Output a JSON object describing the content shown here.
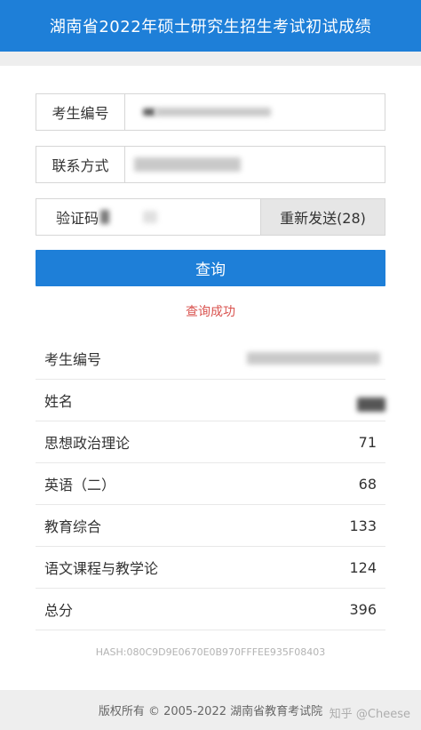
{
  "header": {
    "title": "湖南省2022年硕士研究生招生考试初试成绩"
  },
  "form": {
    "candidate_id_label": "考生编号",
    "contact_label": "联系方式",
    "captcha_label": "验证码",
    "resend_button": "重新发送(28)",
    "query_button": "查询"
  },
  "status": {
    "message": "查询成功"
  },
  "results": {
    "rows": [
      {
        "label": "考生编号",
        "value": ""
      },
      {
        "label": "姓名",
        "value": ""
      },
      {
        "label": "思想政治理论",
        "value": "71"
      },
      {
        "label": "英语（二）",
        "value": "68"
      },
      {
        "label": "教育综合",
        "value": "133"
      },
      {
        "label": "语文课程与教学论",
        "value": "124"
      },
      {
        "label": "总分",
        "value": "396"
      }
    ]
  },
  "hash": "HASH:080C9D9E0670E0B970FFFEE935F08403",
  "footer": {
    "copyright": "版权所有 © 2005-2022 湖南省教育考试院"
  },
  "watermark": "知乎 @Cheese",
  "colors": {
    "primary": "#1e7fd8",
    "status_text": "#d9534f"
  }
}
